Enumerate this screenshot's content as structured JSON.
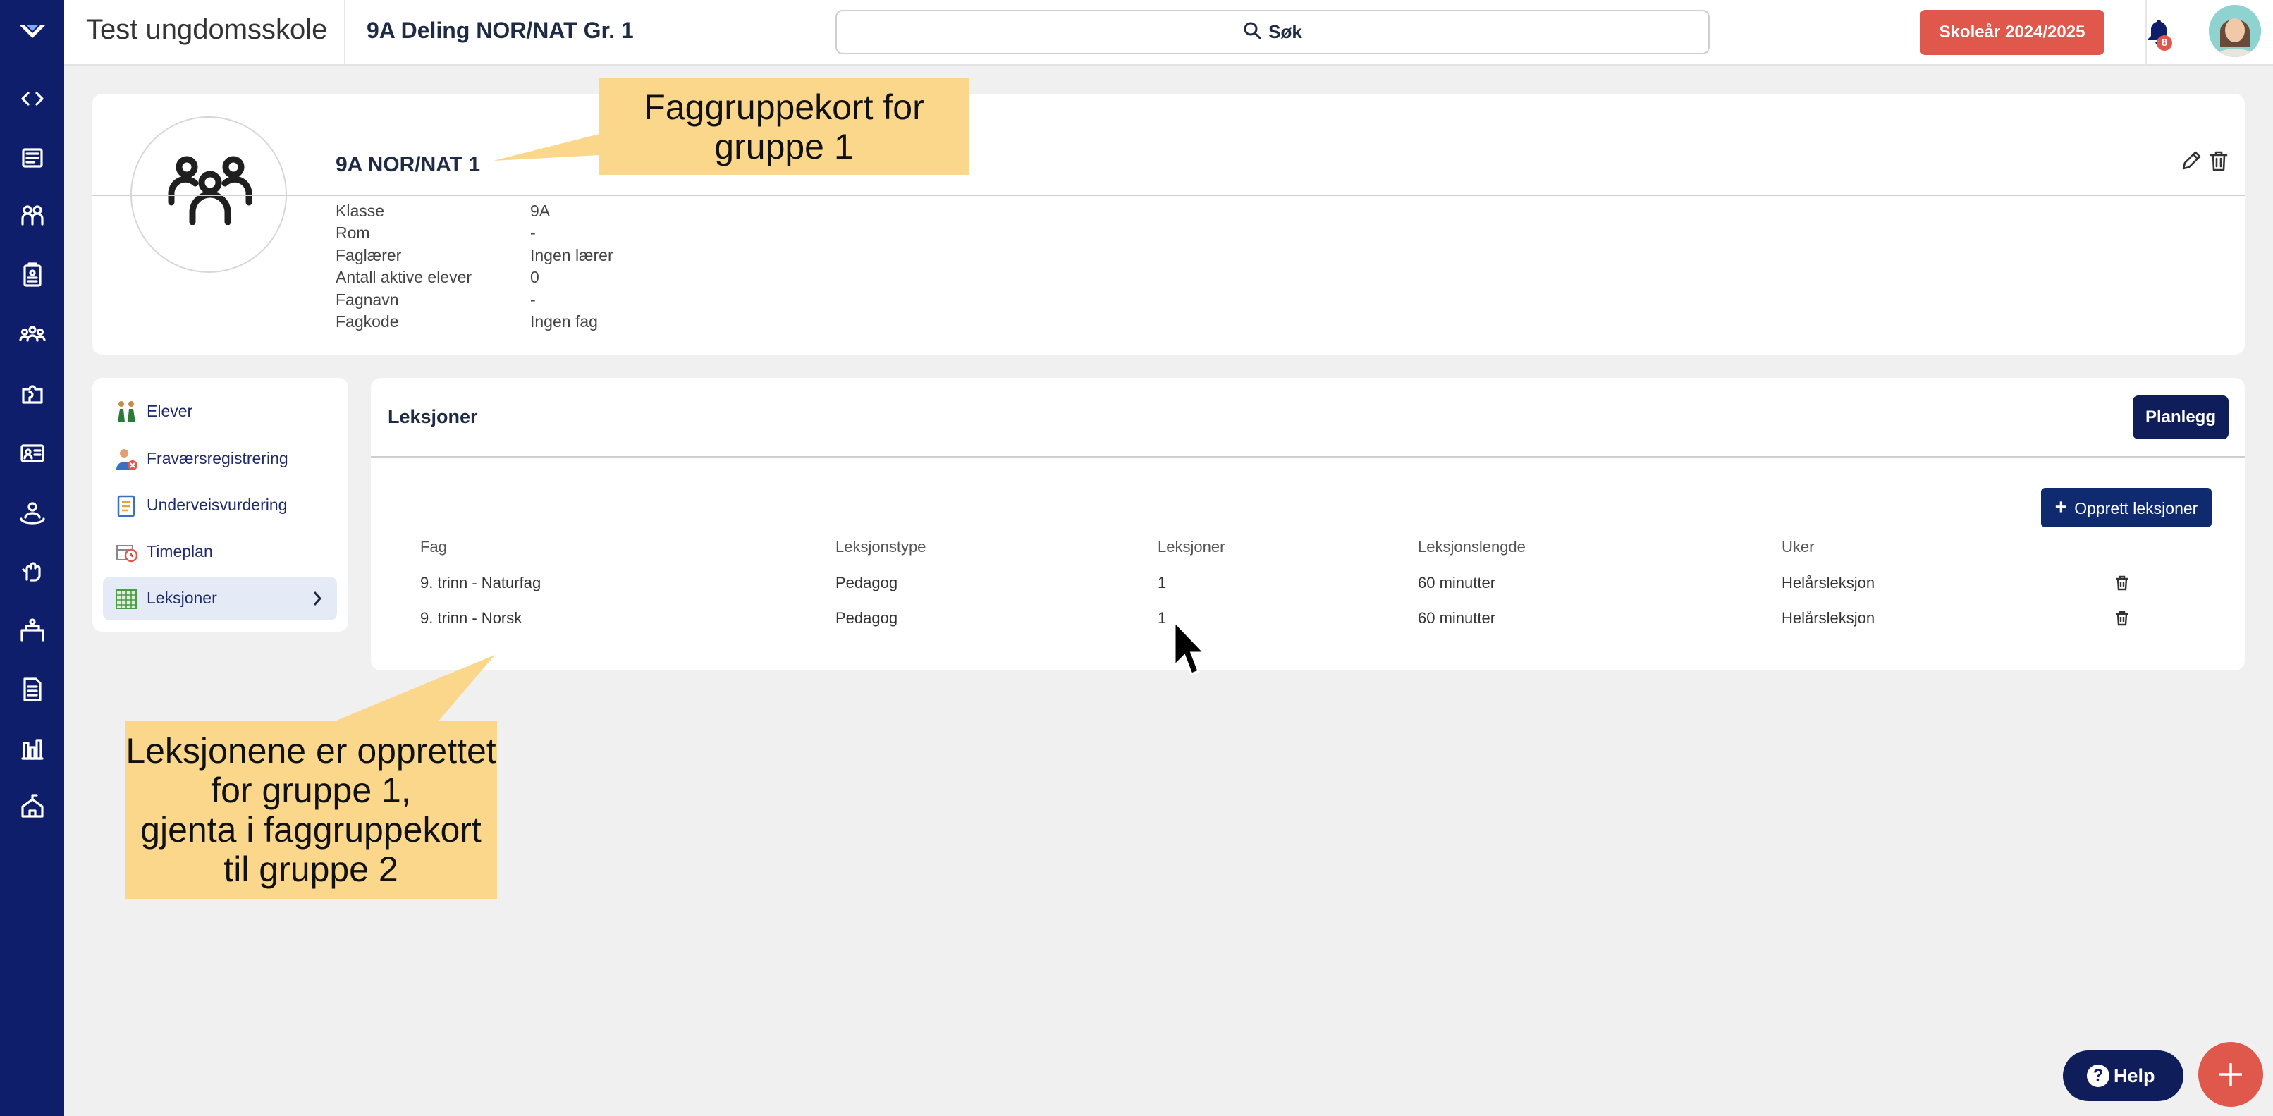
{
  "header": {
    "school_name": "Test ungdomsskole",
    "group_title": "9A Deling NOR/NAT Gr. 1",
    "search_label": "Søk",
    "school_year_button": "Skoleår 2024/2025",
    "notification_count": "8"
  },
  "sidebar": {
    "icons": [
      "code-icon",
      "news-icon",
      "groups-icon",
      "clipboard-icon",
      "people-icon",
      "puzzle-icon",
      "id-card-icon",
      "person-icon",
      "hand-icon",
      "classroom-icon",
      "document-icon",
      "bar-chart-icon",
      "school-icon"
    ]
  },
  "group_card": {
    "name": "9A NOR/NAT 1",
    "info": [
      {
        "label": "Klasse",
        "value": "9A"
      },
      {
        "label": "Rom",
        "value": "-"
      },
      {
        "label": "Faglærer",
        "value": "Ingen lærer"
      },
      {
        "label": "Antall aktive elever",
        "value": "0"
      },
      {
        "label": "Fagnavn",
        "value": "-"
      },
      {
        "label": "Fagkode",
        "value": "Ingen fag"
      }
    ]
  },
  "nav": {
    "items": [
      {
        "label": "Elever"
      },
      {
        "label": "Fraværsregistrering"
      },
      {
        "label": "Underveisvurdering"
      },
      {
        "label": "Timeplan"
      },
      {
        "label": "Leksjoner",
        "active": true
      }
    ]
  },
  "lessons": {
    "title": "Leksjoner",
    "plan_button": "Planlegg",
    "create_button": "Opprett leksjoner",
    "columns": [
      "Fag",
      "Leksjonstype",
      "Leksjoner",
      "Leksjonslengde",
      "Uker"
    ],
    "rows": [
      [
        "9. trinn - Naturfag",
        "Pedagog",
        "1",
        "60 minutter",
        "Helårsleksjon"
      ],
      [
        "9. trinn - Norsk",
        "Pedagog",
        "1",
        "60 minutter",
        "Helårsleksjon"
      ]
    ]
  },
  "callouts": {
    "top_line1": "Faggruppekort for",
    "top_line2": "gruppe 1",
    "bottom_line1": "Leksjonene er opprettet",
    "bottom_line2": "for gruppe 1,",
    "bottom_line3": "gjenta i faggruppekort",
    "bottom_line4": "til gruppe 2"
  },
  "help_button": "Help",
  "colors": {
    "sidebar": "#0f1e6b",
    "accent_red": "#e0574c",
    "primary_dark": "#0f1e5b",
    "callout": "#fad78a"
  }
}
